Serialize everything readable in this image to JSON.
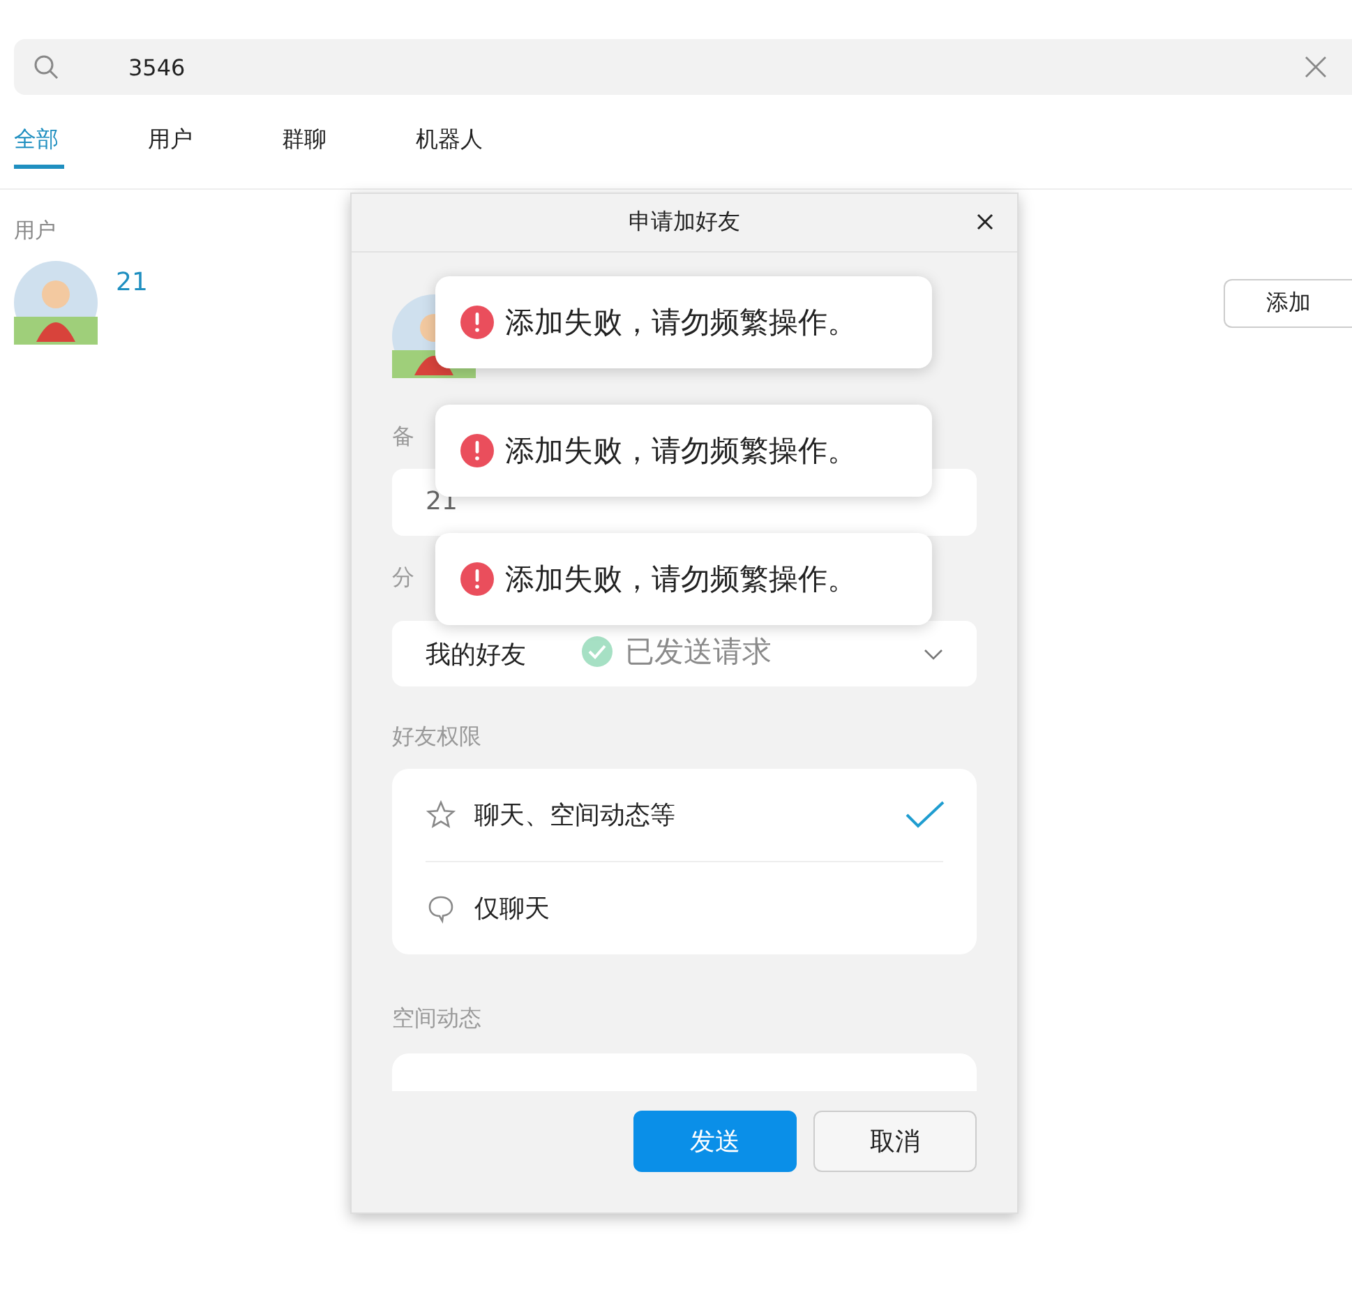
{
  "search": {
    "value": "3546"
  },
  "tabs": [
    {
      "label": "全部",
      "selected": true
    },
    {
      "label": "用户",
      "selected": false
    },
    {
      "label": "群聊",
      "selected": false
    },
    {
      "label": "机器人",
      "selected": false
    }
  ],
  "results": {
    "section": "用户",
    "users": [
      {
        "name": "21",
        "action": "添加"
      }
    ]
  },
  "dialog": {
    "title": "申请加好友",
    "remark": {
      "label": "备",
      "value": "21"
    },
    "group": {
      "label": "分",
      "value": "我的好友"
    },
    "permissions": {
      "label": "好友权限",
      "options": [
        {
          "label": "聊天、空间动态等",
          "kind": "star",
          "selected": true
        },
        {
          "label": "仅聊天",
          "kind": "bubble",
          "selected": false
        }
      ]
    },
    "moments": {
      "label": "空间动态"
    },
    "buttons": [
      {
        "label": "发送",
        "kind": "primary"
      },
      {
        "label": "取消",
        "kind": "secondary"
      }
    ]
  },
  "toasts": [
    {
      "kind": "error",
      "text": "添加失败，请勿频繁操作。"
    },
    {
      "kind": "error",
      "text": "添加失败，请勿频繁操作。"
    },
    {
      "kind": "error",
      "text": "添加失败，请勿频繁操作。"
    },
    {
      "kind": "success",
      "text": "已发送请求"
    }
  ]
}
